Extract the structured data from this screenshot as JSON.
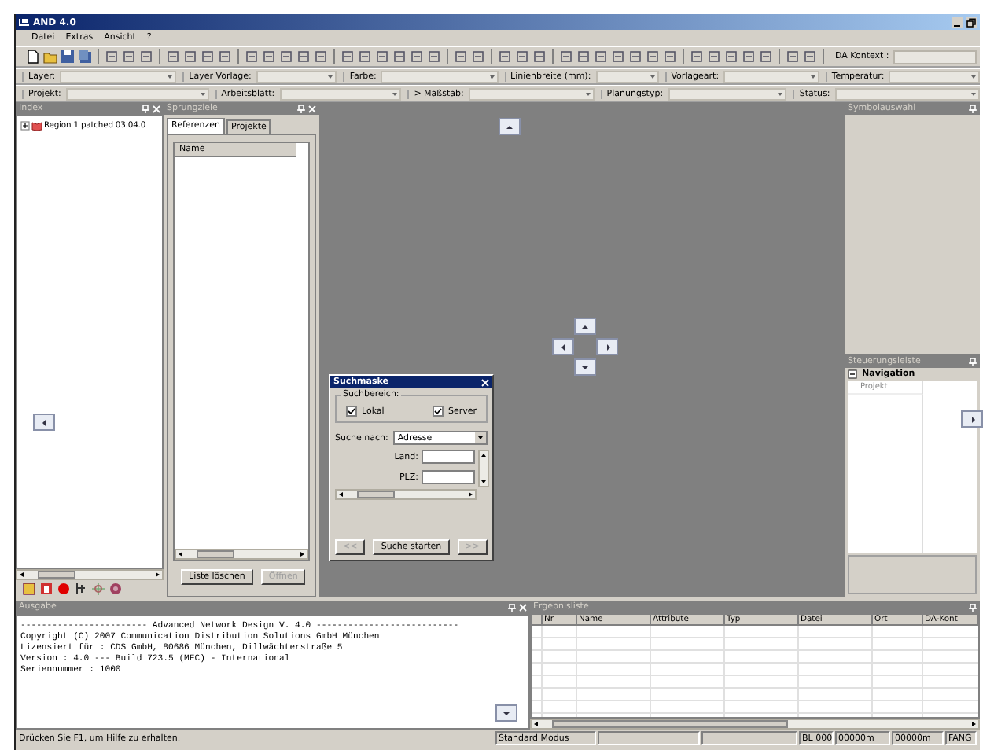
{
  "window": {
    "title": "AND 4.0"
  },
  "menu": [
    {
      "label": "Datei"
    },
    {
      "label": "Extras"
    },
    {
      "label": "Ansicht"
    },
    {
      "label": "?"
    }
  ],
  "toolbar": {
    "context_label": "DA Kontext :"
  },
  "field_rows": [
    [
      {
        "label": "Layer:"
      },
      {
        "label": "Layer Vorlage:"
      },
      {
        "label": "Farbe:"
      },
      {
        "label": "Linienbreite (mm):"
      },
      {
        "label": "Vorlageart:"
      },
      {
        "label": "Temperatur:"
      }
    ],
    [
      {
        "label": "Projekt:"
      },
      {
        "label": "Arbeitsblatt:"
      },
      {
        "label": "> Maßstab:"
      },
      {
        "label": "Planungstyp:"
      },
      {
        "label": "Status:"
      }
    ]
  ],
  "index_panel": {
    "title": "Index",
    "tree": [
      {
        "label": "Region 1 patched 03.04.0",
        "expanded": false
      }
    ]
  },
  "jump_panel": {
    "title": "Sprungziele",
    "tabs": [
      {
        "label": "Referenzen",
        "selected": true
      },
      {
        "label": "Projekte",
        "selected": false
      }
    ],
    "column": "Name",
    "buttons": [
      {
        "label": "Liste löschen",
        "disabled": false
      },
      {
        "label": "Öffnen",
        "disabled": true
      }
    ]
  },
  "search_dialog": {
    "title": "Suchmaske",
    "group": "Suchbereich:",
    "checks": [
      {
        "label": "Lokal",
        "checked": true
      },
      {
        "label": "Server",
        "checked": true
      }
    ],
    "search_by": {
      "label": "Suche nach:",
      "value": "Adresse"
    },
    "fields": [
      {
        "label": "Land:"
      },
      {
        "label": "PLZ:"
      }
    ],
    "buttons": [
      {
        "label": "<<",
        "disabled": true
      },
      {
        "label": "Suche starten",
        "disabled": false
      },
      {
        "label": ">>",
        "disabled": true
      }
    ]
  },
  "symbol_panel": {
    "title": "Symbolauswahl"
  },
  "control_panel": {
    "title": "Steuerungsleiste",
    "section": {
      "label": "Navigation",
      "expanded": true
    },
    "items": [
      {
        "label": "Projekt"
      }
    ]
  },
  "output_panel": {
    "title": "Ausgabe",
    "lines": [
      "------------------------ Advanced Network Design V. 4.0 ---------------------------",
      "Copyright (C) 2007 Communication Distribution Solutions GmbH München",
      "Lizensiert für : CDS GmbH, 80686 München, Dillwächterstraße 5",
      "Version : 4.0 --- Build 723.5 (MFC) - International",
      "Seriennummer : 1000"
    ]
  },
  "results_panel": {
    "title": "Ergebnisliste",
    "columns": [
      "Nr",
      "Name",
      "Attribute",
      "Typ",
      "Datei",
      "Ort",
      "DA-Kont"
    ]
  },
  "status_bar": {
    "message": "Drücken Sie F1, um Hilfe zu erhalten.",
    "cells": [
      "Standard Modus",
      "",
      "",
      "BL 000",
      "00000m",
      "00000m",
      "FANG"
    ]
  }
}
